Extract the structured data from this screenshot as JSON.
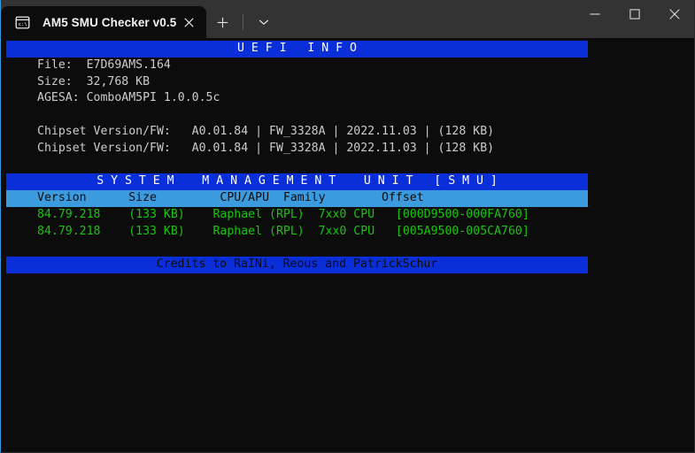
{
  "window": {
    "tab": {
      "title": "AM5 SMU Checker v0.5",
      "icon": "console-icon",
      "close_icon": "close-icon"
    },
    "new_tab_icon": "plus-icon",
    "dropdown_icon": "chevron-down-icon",
    "controls": {
      "minimize_icon": "minimize-icon",
      "maximize_icon": "maximize-icon",
      "close_icon": "close-icon"
    }
  },
  "terminal": {
    "uefi": {
      "header": "U E F I   I N F O",
      "lines": [
        "File:  E7D69AMS.164",
        "Size:  32,768 KB",
        "AGESA: ComboAM5PI 1.0.0.5c"
      ],
      "chipset": [
        "Chipset Version/FW:   A0.01.84 | FW_3328A | 2022.11.03 | (128 KB)",
        "Chipset Version/FW:   A0.01.84 | FW_3328A | 2022.11.03 | (128 KB)"
      ]
    },
    "smu": {
      "header": "S Y S T E M    M A N A G E M E N T    U N I T   [ S M U ]",
      "columns": "Version      Size         CPU/APU  Family        Offset",
      "rows": [
        "84.79.218    (133 KB)    Raphael (RPL)  7xx0 CPU   [000D9500-000FA760]",
        "84.79.218    (133 KB)    Raphael (RPL)  7xx0 CPU   [005A9500-005CA760]"
      ]
    },
    "credits": "Credits to RaINi, Reous and PatrickSchur"
  },
  "colors": {
    "background": "#0c0c0c",
    "title_bar_blue": "#0a2ed8",
    "column_bar_blue": "#3b9bde",
    "green_text": "#16c60c",
    "titlebar_gray": "#333333"
  }
}
